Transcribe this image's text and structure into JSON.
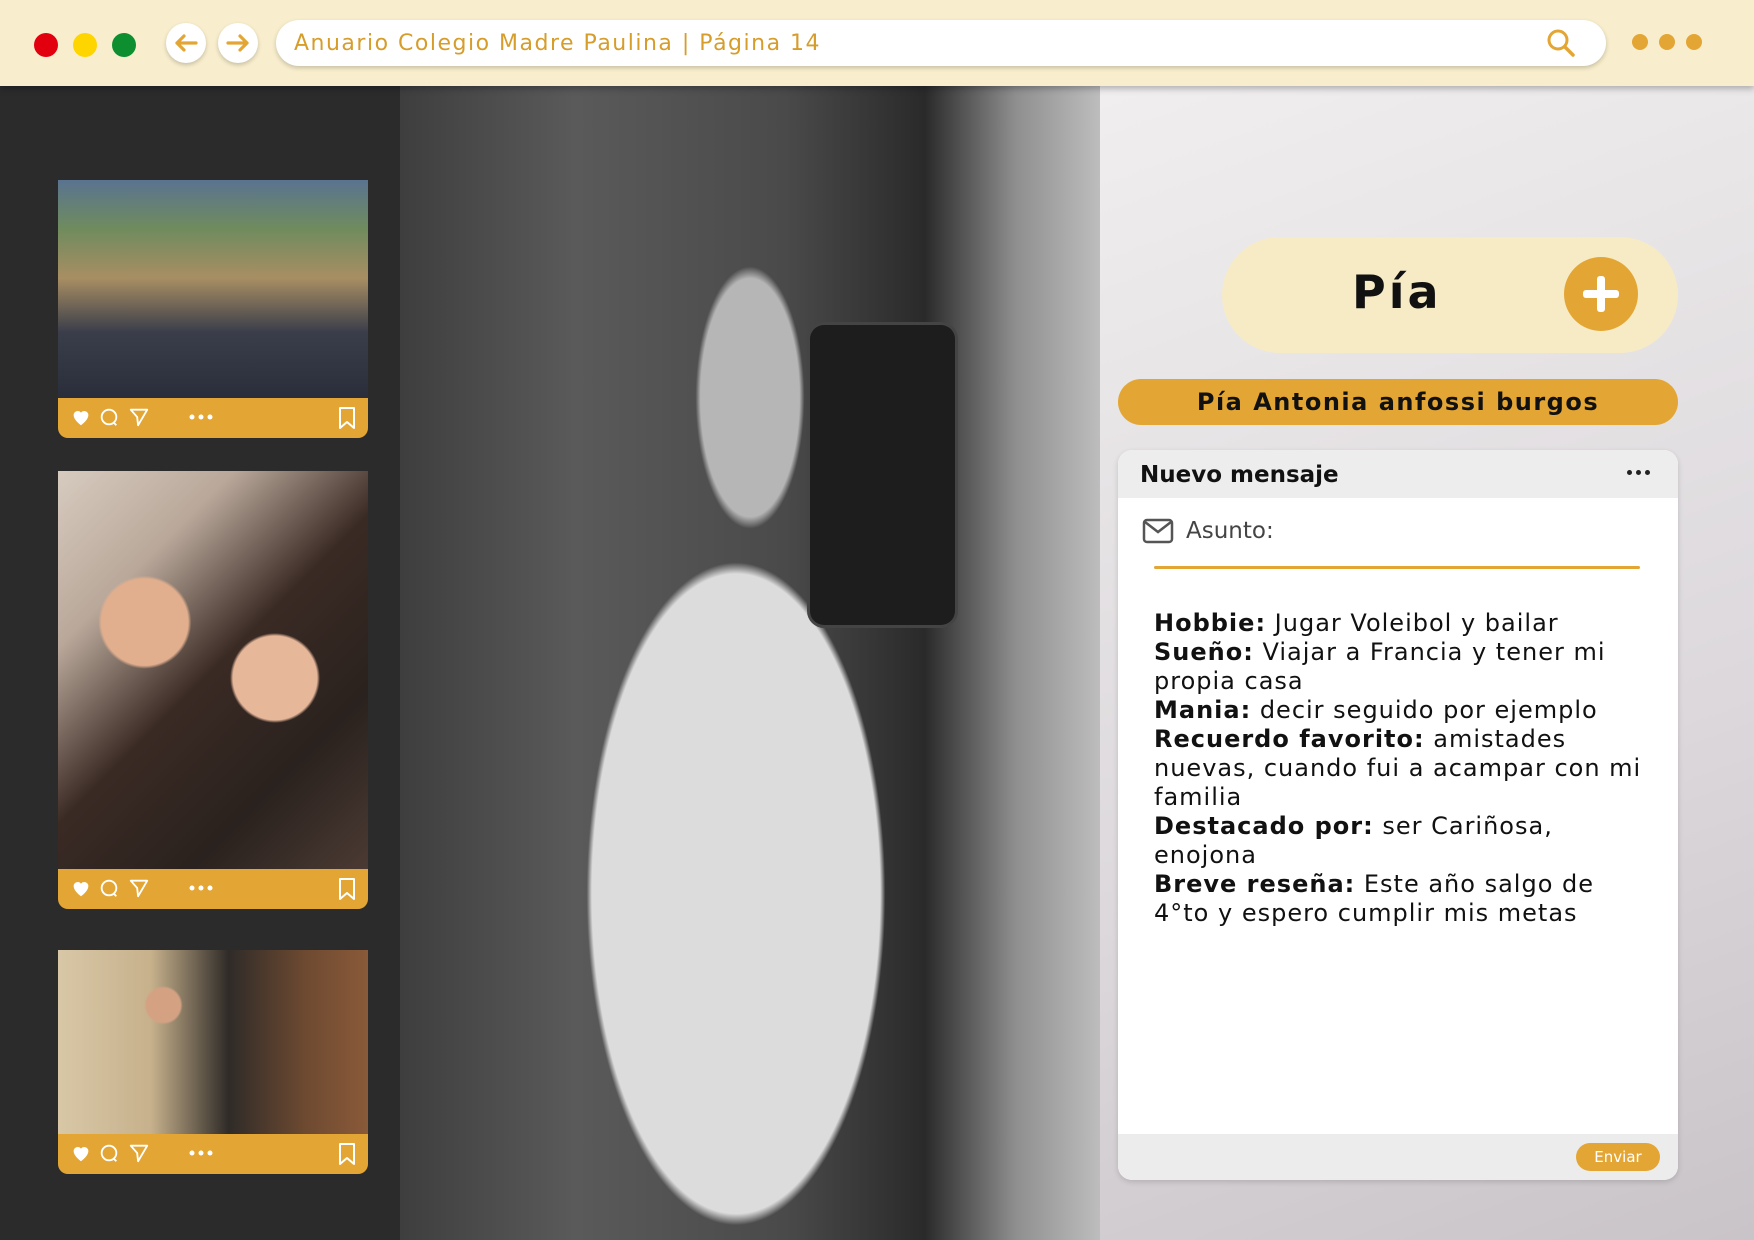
{
  "browser": {
    "url_text": "Anuario Colegio Madre Paulina | Página 14",
    "icons": [
      "close-dot",
      "minimize-dot",
      "maximize-dot",
      "arrow-left-icon",
      "arrow-right-icon",
      "search-icon",
      "more-dots-icon"
    ]
  },
  "posts": [
    {
      "photo": "family-photo"
    },
    {
      "photo": "friends-selfie"
    },
    {
      "photo": "seated-portrait"
    }
  ],
  "post_actions": [
    "heart-icon",
    "comment-icon",
    "send-icon",
    "more-icon",
    "bookmark-icon"
  ],
  "profile": {
    "short_name": "Pía",
    "full_name": "Pía Antonia anfossi burgos"
  },
  "message": {
    "header": "Nuevo mensaje",
    "subject_label": "Asunto:",
    "send_label": "Enviar",
    "fields": [
      {
        "label": "Hobbie:",
        "value": "  Jugar Voleibol y bailar"
      },
      {
        "label": "Sueño:",
        "value": " Viajar a Francia y tener mi propia casa"
      },
      {
        "label": "Mania:",
        "value": " decir seguido por ejemplo"
      },
      {
        "label": "Recuerdo favorito:",
        "value": " amistades nuevas, cuando fui a acampar con mi familia"
      },
      {
        "label": "Destacado por:",
        "value": " ser Cariñosa, enojona"
      },
      {
        "label": "Breve reseña:",
        "value": " Este año salgo de 4°to y espero cumplir mis metas"
      }
    ]
  },
  "colors": {
    "accent": "#e3a634",
    "topbar": "#f8eecd",
    "dark_bg": "#2b2b2b"
  }
}
